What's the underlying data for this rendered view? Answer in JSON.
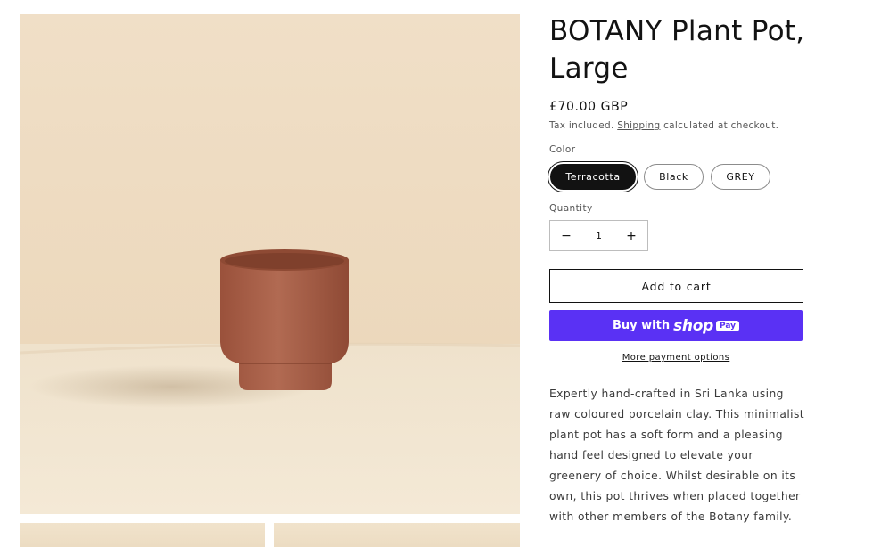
{
  "product": {
    "title": "BOTANY Plant Pot, Large",
    "price": "£70.00 GBP",
    "tax_prefix": "Tax included.",
    "shipping_link": "Shipping",
    "tax_suffix": "calculated at checkout."
  },
  "variant": {
    "label": "Color",
    "options": [
      {
        "label": "Terracotta",
        "selected": true
      },
      {
        "label": "Black",
        "selected": false
      },
      {
        "label": "GREY",
        "selected": false
      }
    ]
  },
  "quantity": {
    "label": "Quantity",
    "value": "1",
    "minus": "−",
    "plus": "+"
  },
  "actions": {
    "add_to_cart": "Add to cart",
    "buy_with": "Buy with",
    "shop": "shop",
    "pay": "Pay",
    "more_payment": "More payment options"
  },
  "description": "Expertly hand-crafted in Sri Lanka using raw coloured porcelain clay. This minimalist plant pot has a soft form and a pleasing hand feel designed to elevate your greenery of choice. Whilst desirable on its own, this pot thrives when placed together with other members of the Botany family.",
  "colors": {
    "pot": "#a45a43",
    "shop_pay": "#5a31f4",
    "background_wall": "#efdcc2"
  }
}
